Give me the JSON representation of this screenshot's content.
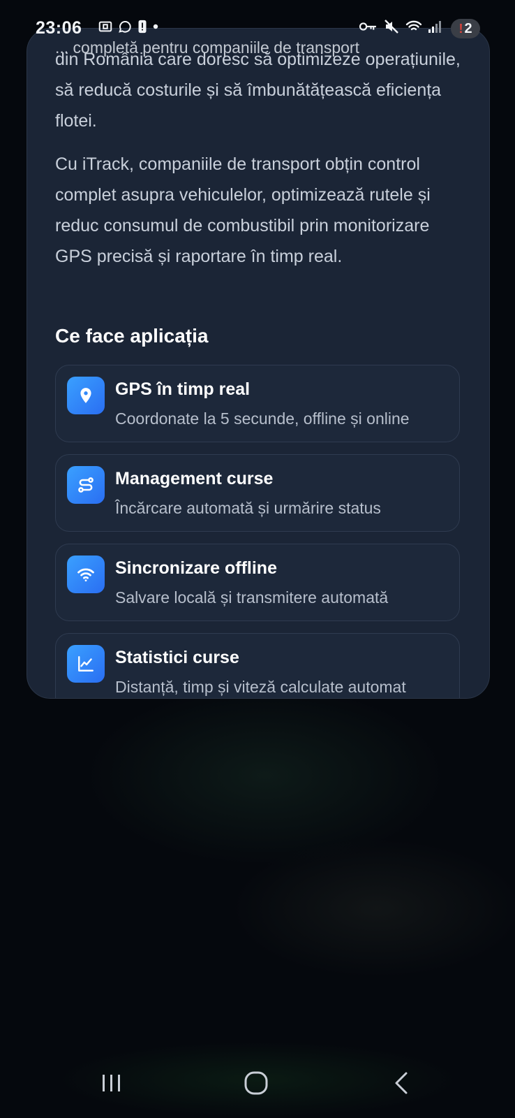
{
  "status_bar": {
    "time": "23:06",
    "notification_count": "2",
    "notification_alert": "!",
    "icons_left": [
      "screenshot-icon",
      "whatsapp-icon",
      "alert-icon",
      "dot-icon"
    ],
    "icons_right": [
      "vpn-key-icon",
      "mute-icon",
      "wifi-icon",
      "signal-icon"
    ]
  },
  "content": {
    "intro_cut": "... completă pentru companiile de transport",
    "paragraph1": "din România care doresc să optimizeze operațiunile, să reducă costurile și să îmbunătățească eficiența flotei.",
    "paragraph2": "Cu iTrack, companiile de transport obțin control complet asupra vehiculelor, optimizează rutele și reduc consumul de combustibil prin monitorizare GPS precisă și raportare în timp real.",
    "section_title": "Ce face aplicația",
    "features": [
      {
        "icon": "location-pin-icon",
        "title": "GPS în timp real",
        "desc": "Coordonate la 5 secunde, offline și online"
      },
      {
        "icon": "route-icon",
        "title": "Management curse",
        "desc": "Încărcare automată și urmărire status"
      },
      {
        "icon": "wifi-icon",
        "title": "Sincronizare offline",
        "desc": "Salvare locală și transmitere automată"
      },
      {
        "icon": "chart-icon",
        "title": "Statistici curse",
        "desc": "Distanță, timp și viteză calculate automat"
      }
    ]
  },
  "nav_bar": {
    "buttons": [
      "recent-apps-icon",
      "home-icon",
      "back-icon"
    ]
  },
  "colors": {
    "card_bg": "#1b2536",
    "accent": "#2f8cf8",
    "page_bg": "#05080d"
  }
}
